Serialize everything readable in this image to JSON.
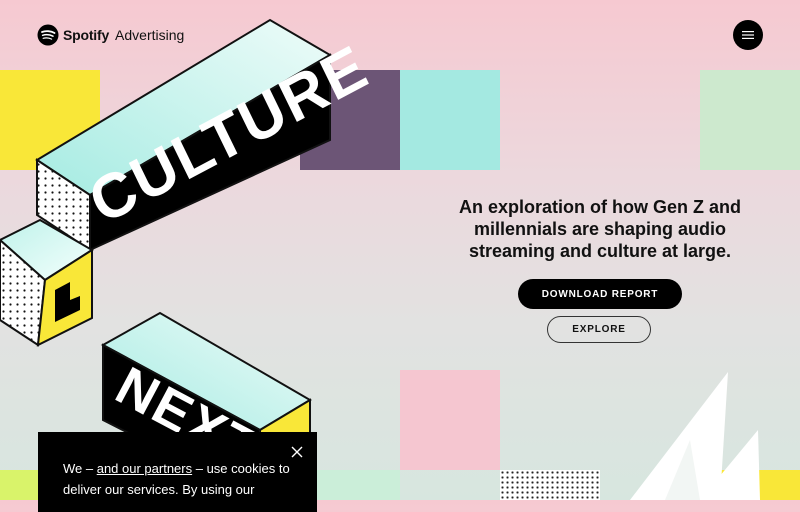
{
  "header": {
    "brand_name": "Spotify",
    "brand_sub": "Advertising",
    "menu_icon": "hamburger-icon"
  },
  "illustration": {
    "block_word_1": "CULTURE",
    "block_word_2": "NEXT"
  },
  "hero": {
    "text": "An exploration of how Gen Z and millennials are shaping audio streaming and culture at large.",
    "download_label": "DOWNLOAD REPORT",
    "explore_label": "EXPLORE"
  },
  "cookie_banner": {
    "text_before": "We – ",
    "link_text": "and our partners",
    "text_after": " – use cookies to deliver our services. By using our",
    "close_icon": "close-icon"
  },
  "colors": {
    "yellow": "#f9e738",
    "purple": "#6c5576",
    "teal": "#a4e9e1",
    "mint": "#cde9ce",
    "pink": "#f5c6d0",
    "black": "#000000"
  }
}
